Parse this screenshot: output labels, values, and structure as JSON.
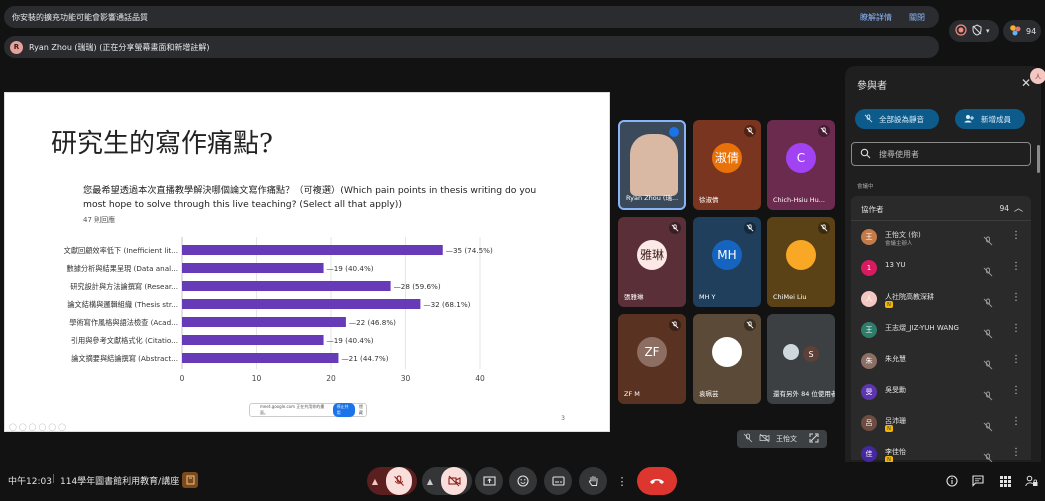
{
  "banners": {
    "warning": "你安裝的擴充功能可能會影響通話品質",
    "details_link": "瞭解詳情",
    "close_link": "關閉",
    "presenter_initial": "R",
    "presenter_status": "Ryan Zhou (瑞瑞) (正在分享螢幕畫面和新增註解)"
  },
  "top_right": {
    "participant_count": "94"
  },
  "slide": {
    "title": "研究生的寫作痛點?",
    "question": "您最希望透過本次直播教學解決哪個論文寫作痛點？（可複選）(Which pain points in thesis writing do you most hope to solve through this live teaching? (Select all that apply))",
    "responses": "47 則回應",
    "footer_url": "meet.google.com 正在共用你的畫面。",
    "footer_stop": "停止共用",
    "footer_hide": "隱藏",
    "page_number": "3"
  },
  "chart_data": {
    "type": "bar",
    "orientation": "horizontal",
    "categories": [
      "文獻回顧效率低下 (Inefficient lit...",
      "數據分析與結果呈現 (Data anal...",
      "研究設計與方法論撰寫 (Resear...",
      "論文結構與邏輯組織 (Thesis str...",
      "學術寫作風格與語法檢查 (Acad...",
      "引用與參考文獻格式化 (Citatio...",
      "論文摘要與結論撰寫 (Abstract..."
    ],
    "values": [
      35,
      19,
      28,
      32,
      22,
      19,
      21
    ],
    "value_labels": [
      "35 (74.5%)",
      "19 (40.4%)",
      "28 (59.6%)",
      "32 (68.1%)",
      "22 (46.8%)",
      "19 (40.4%)",
      "21 (44.7%)"
    ],
    "xlim": [
      0,
      40
    ],
    "xticks": [
      "0",
      "10",
      "20",
      "30",
      "40"
    ],
    "bar_color": "#673ab7",
    "grid": true
  },
  "tiles": [
    {
      "name": "Ryan Zhou (瑞...",
      "label": "",
      "color": "#3b4a5a"
    },
    {
      "name": "徐淑倩",
      "label": "淑倩",
      "color": "#7a3520"
    },
    {
      "name": "Chich-Hsiu Hu...",
      "label": "C",
      "color": "#6b2b4e"
    },
    {
      "name": "張雅琳",
      "label": "雅琳",
      "color": "#5a2f38"
    },
    {
      "name": "MH Y",
      "label": "MH",
      "color": "#1f3f5c"
    },
    {
      "name": "ChiMei Liu",
      "label": "",
      "color": "#5b4216"
    },
    {
      "name": "ZF M",
      "label": "ZF",
      "color": "#5a3221"
    },
    {
      "name": "袁珮芸",
      "label": "",
      "color": "#5b4a38"
    },
    {
      "name": "還有另外 84 位使用者",
      "label": "S",
      "color": "#3c4043"
    }
  ],
  "self_view": {
    "name": "王怡文"
  },
  "panel": {
    "title": "參與者",
    "mute_all": "全部設為靜音",
    "add_people": "新增成員",
    "search_placeholder": "搜尋使用者",
    "in_meeting": "會議中",
    "collaborators": "協作者",
    "collaborators_count": "94",
    "people": [
      {
        "name": "王怡文 (你)",
        "sub": "會議主辦人",
        "initial": "王",
        "color": "#c47b4a",
        "badge": ""
      },
      {
        "name": "13 YU",
        "sub": "",
        "initial": "1",
        "color": "#d81b60",
        "badge": ""
      },
      {
        "name": "人社院高教深耕",
        "sub": "",
        "initial": "人",
        "color": "#f4c7c3",
        "badge": "N"
      },
      {
        "name": "王志熠_JIZ-YUH WANG",
        "sub": "",
        "initial": "王",
        "color": "#2e7d6b",
        "badge": ""
      },
      {
        "name": "朱允慧",
        "sub": "",
        "initial": "朱",
        "color": "#8d6e63",
        "badge": ""
      },
      {
        "name": "吳旻勳",
        "sub": "",
        "initial": "旻",
        "color": "#5e35b1",
        "badge": ""
      },
      {
        "name": "呂沛珊",
        "sub": "",
        "initial": "呂",
        "color": "#6d4c41",
        "badge": "N"
      },
      {
        "name": "李佳怡",
        "sub": "",
        "initial": "佳",
        "color": "#4527a0",
        "badge": "N"
      }
    ]
  },
  "bottom": {
    "clock": "中午12:03",
    "meeting_name": "114學年圖書館利用教育/講座"
  }
}
